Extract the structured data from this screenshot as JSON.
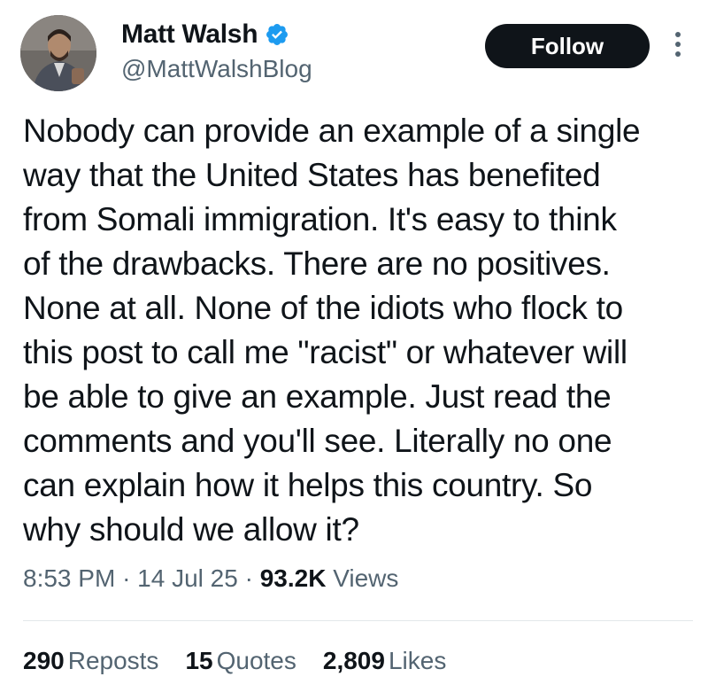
{
  "author": {
    "display_name": "Matt Walsh",
    "handle": "@MattWalshBlog",
    "verified": true,
    "verified_color": "#1d9bf0"
  },
  "actions": {
    "follow_label": "Follow"
  },
  "tweet": {
    "text_lines": [
      "Nobody can provide an example of a single",
      "way that the United States has benefited",
      "from Somali immigration. It's easy to think",
      "of the drawbacks. There are no positives.",
      "None at all. None of the idiots who flock to",
      "this post to call me \"racist\" or whatever will",
      "be able to give an example. Just read the",
      "comments and you'll see. Literally no one",
      "can explain how it helps this country. So",
      "why should we allow it?"
    ],
    "time": "8:53 PM",
    "date": "14 Jul 25",
    "separator": "·",
    "views_count": "93.2K",
    "views_label": "Views"
  },
  "stats": {
    "reposts_count": "290",
    "reposts_label": "Reposts",
    "quotes_count": "15",
    "quotes_label": "Quotes",
    "likes_count": "2,809",
    "likes_label": "Likes"
  },
  "icons": {
    "verified": "verified-badge-icon",
    "more": "more-options-icon"
  }
}
